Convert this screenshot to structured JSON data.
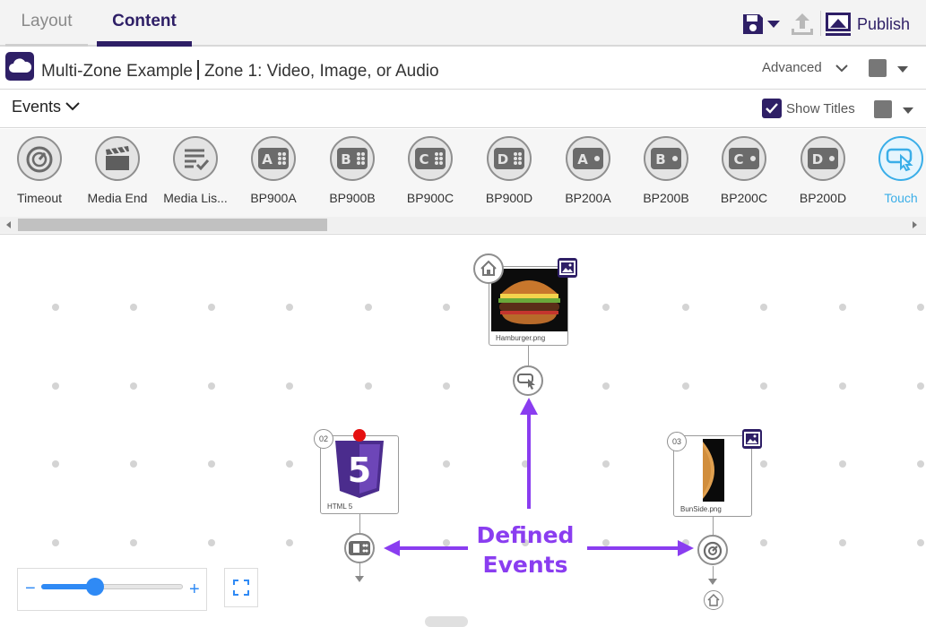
{
  "tabs": {
    "layout": "Layout",
    "content": "Content"
  },
  "toolbar": {
    "publish_label": "Publish"
  },
  "title": {
    "presentation": "Multi-Zone Example",
    "zone": "Zone 1: Video, Image, or Audio",
    "advanced_label": "Advanced"
  },
  "events_bar": {
    "label": "Events",
    "show_titles_label": "Show Titles",
    "show_titles_checked": true
  },
  "palette": [
    {
      "label": "Timeout",
      "icon": "timeout-icon"
    },
    {
      "label": "Media End",
      "icon": "clapperboard-icon"
    },
    {
      "label": "Media Lis...",
      "icon": "media-list-icon"
    },
    {
      "label": "BP900A",
      "icon": "button-panel-icon",
      "letter": "A"
    },
    {
      "label": "BP900B",
      "icon": "button-panel-icon",
      "letter": "B"
    },
    {
      "label": "BP900C",
      "icon": "button-panel-icon",
      "letter": "C"
    },
    {
      "label": "BP900D",
      "icon": "button-panel-icon",
      "letter": "D"
    },
    {
      "label": "BP200A",
      "icon": "button-panel-icon",
      "letter": "A"
    },
    {
      "label": "BP200B",
      "icon": "button-panel-icon",
      "letter": "B"
    },
    {
      "label": "BP200C",
      "icon": "button-panel-icon",
      "letter": "C"
    },
    {
      "label": "BP200D",
      "icon": "button-panel-icon",
      "letter": "D"
    },
    {
      "label": "Touch",
      "icon": "touch-icon"
    }
  ],
  "canvas": {
    "nodes": {
      "hamburger": {
        "caption": "Hamburger.png"
      },
      "html5": {
        "caption": "HTML 5",
        "badge": "02",
        "html_label": "5"
      },
      "bunside": {
        "caption": "BunSide.png",
        "badge": "03"
      }
    },
    "annotation": {
      "line1": "Defined",
      "line2": "Events"
    },
    "zoom": {
      "minus": "−",
      "plus": "+",
      "level": 0.38
    }
  },
  "colors": {
    "brand": "#2e1f66",
    "accent_touch": "#3aaee8",
    "annotation": "#8a3df0",
    "zoom": "#2f8af5",
    "alert_dot": "#e51010"
  }
}
